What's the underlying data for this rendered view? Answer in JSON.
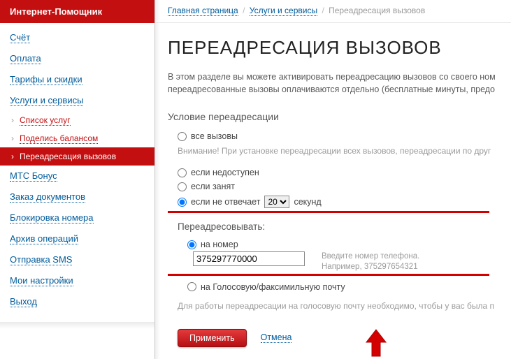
{
  "sidebar": {
    "title": "Интернет-Помощник",
    "items": [
      {
        "label": "Счёт",
        "name": "sidebar-item-account"
      },
      {
        "label": "Оплата",
        "name": "sidebar-item-payment"
      },
      {
        "label": "Тарифы и скидки",
        "name": "sidebar-item-tariffs"
      },
      {
        "label": "Услуги и сервисы",
        "name": "sidebar-item-services",
        "children": [
          {
            "label": "Список услуг",
            "name": "sidebar-sub-service-list"
          },
          {
            "label": "Поделись балансом",
            "name": "sidebar-sub-share-balance"
          },
          {
            "label": "Переадресация вызовов",
            "name": "sidebar-sub-call-forwarding",
            "active": true
          }
        ]
      },
      {
        "label": "МТС Бонус",
        "name": "sidebar-item-bonus"
      },
      {
        "label": "Заказ документов",
        "name": "sidebar-item-docs"
      },
      {
        "label": "Блокировка номера",
        "name": "sidebar-item-block"
      },
      {
        "label": "Архив операций",
        "name": "sidebar-item-archive"
      },
      {
        "label": "Отправка SMS",
        "name": "sidebar-item-sms"
      },
      {
        "label": "Мои настройки",
        "name": "sidebar-item-settings"
      },
      {
        "label": "Выход",
        "name": "sidebar-item-logout"
      }
    ]
  },
  "breadcrumb": {
    "home": "Главная страница",
    "services": "Услуги и сервисы",
    "current": "Переадресация вызовов"
  },
  "page": {
    "title": "ПЕРЕАДРЕСАЦИЯ ВЫЗОВОВ",
    "intro": "В этом разделе вы можете активировать переадресацию вызовов со своего ном\nпереадресованные вызовы оплачиваются отдельно (бесплатные минуты, предо",
    "condition_title": "Условие переадресации",
    "option_all": "все вызовы",
    "warning_all": "Внимание! При установке переадресации всех вызовов, переадресации по друг",
    "option_unreach": "если недоступен",
    "option_busy": "если занят",
    "option_noanswer": "если не отвечает",
    "seconds_value": "20",
    "seconds_label": "секунд",
    "forward_title": "Переадресовывать:",
    "option_number": "на номер",
    "phone_value": "375297770000",
    "phone_hint1": "Введите номер телефона.",
    "phone_hint2": "Например, 375297654321",
    "option_voicemail": "на Голосовую/факсимильную почту",
    "vm_note": "Для работы переадресации на голосовую почту необходимо, чтобы у вас была п",
    "apply": "Применить",
    "cancel": "Отмена"
  }
}
